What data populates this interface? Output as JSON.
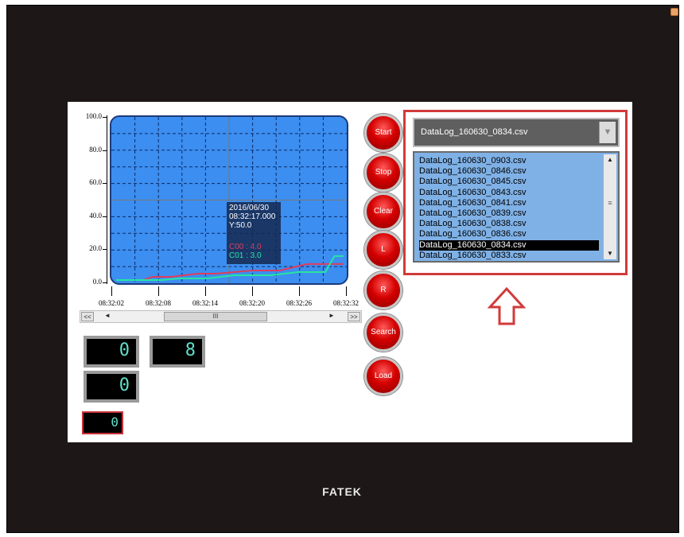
{
  "device": {
    "brand": "FATEK"
  },
  "chart_data": {
    "type": "line",
    "yticks": [
      "100.0",
      "80.0",
      "60.0",
      "40.0",
      "20.0",
      "0.0"
    ],
    "ylim": [
      0,
      100
    ],
    "xticks": [
      "08:32:02",
      "08:32:08",
      "08:32:14",
      "08:32:20",
      "08:32:26",
      "08:32:32"
    ],
    "grid": true,
    "series": [
      {
        "name": "C00",
        "color": "#e03c5a",
        "x": [
          0,
          6,
          8,
          12,
          18,
          22,
          30,
          36,
          42,
          48,
          50
        ],
        "y": [
          0,
          0,
          2,
          2,
          4,
          4,
          6,
          6,
          10,
          10,
          10
        ]
      },
      {
        "name": "C01",
        "color": "#27e5a0",
        "x": [
          0,
          10,
          14,
          20,
          26,
          34,
          40,
          46,
          48,
          50
        ],
        "y": [
          0,
          0,
          1,
          1,
          3,
          3,
          5,
          5,
          15,
          15
        ]
      }
    ],
    "tooltip": {
      "date": "2016/06/30",
      "time": "08:32:17.000",
      "y": "Y:50.0",
      "c00": "C00 : 4.0",
      "c01": "C01 : 3.0"
    }
  },
  "scrollbar": {
    "first": "<<",
    "last": ">>",
    "prev": "◄",
    "next": "►",
    "grip": "III"
  },
  "buttons": {
    "start": "Start",
    "stop": "Stop",
    "clear": "Clear",
    "left": "L",
    "right": "R",
    "search": "Search",
    "load": "Load"
  },
  "displays": {
    "d1": "0",
    "d2": "8",
    "d3": "0",
    "d4": "0"
  },
  "dropdown": {
    "selected": "DataLog_160630_0834.csv",
    "arrow": "▼"
  },
  "files": [
    "DataLog_160630_0903.csv",
    "DataLog_160630_0846.csv",
    "DataLog_160630_0845.csv",
    "DataLog_160630_0843.csv",
    "DataLog_160630_0841.csv",
    "DataLog_160630_0839.csv",
    "DataLog_160630_0838.csv",
    "DataLog_160630_0836.csv",
    "DataLog_160630_0834.csv",
    "DataLog_160630_0833.csv"
  ],
  "selected_file_index": 8,
  "list_scroll": {
    "up": "▲",
    "down": "▼",
    "grip": "≡"
  },
  "highlight": {
    "color": "#d23a3a"
  }
}
